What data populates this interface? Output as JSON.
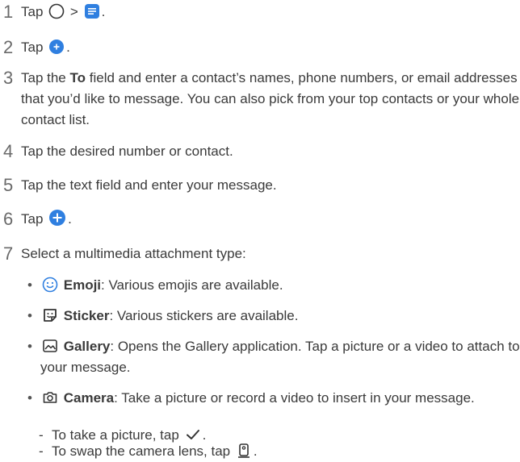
{
  "steps": {
    "s1": {
      "num": "1",
      "a": "Tap",
      "b": ">",
      "c": "."
    },
    "s2": {
      "num": "2",
      "a": "Tap",
      "c": "."
    },
    "s3": {
      "num": "3",
      "a": "Tap the",
      "bold": "To",
      "rest": "field and enter a contact’s names, phone numbers, or email addresses that you’d like to message. You can also pick from your top contacts or your whole contact list."
    },
    "s4": {
      "num": "4",
      "text": "Tap the desired number or contact."
    },
    "s5": {
      "num": "5",
      "text": "Tap the text field and enter your message."
    },
    "s6": {
      "num": "6",
      "a": "Tap",
      "c": "."
    },
    "s7": {
      "num": "7",
      "text": "Select a multimedia attachment type:"
    }
  },
  "bullets": {
    "emoji": {
      "mark": "•",
      "title": "Emoji",
      "text": ": Various emojis are available."
    },
    "sticker": {
      "mark": "•",
      "title": "Sticker",
      "text": ": Various stickers are available."
    },
    "gallery": {
      "mark": "•",
      "title": "Gallery",
      "text": ": Opens the Gallery application. Tap a picture or a video to attach to your message."
    },
    "camera": {
      "mark": "•",
      "title": "Camera",
      "text": ": Take a picture or record a video to insert in your message."
    }
  },
  "subs": {
    "take": {
      "mark": "-",
      "a": "To take a picture, tap",
      "c": "."
    },
    "swap": {
      "mark": "-",
      "a": "To swap the camera lens, tap",
      "c": "."
    }
  },
  "colors": {
    "accent": "#2f7fe0"
  }
}
